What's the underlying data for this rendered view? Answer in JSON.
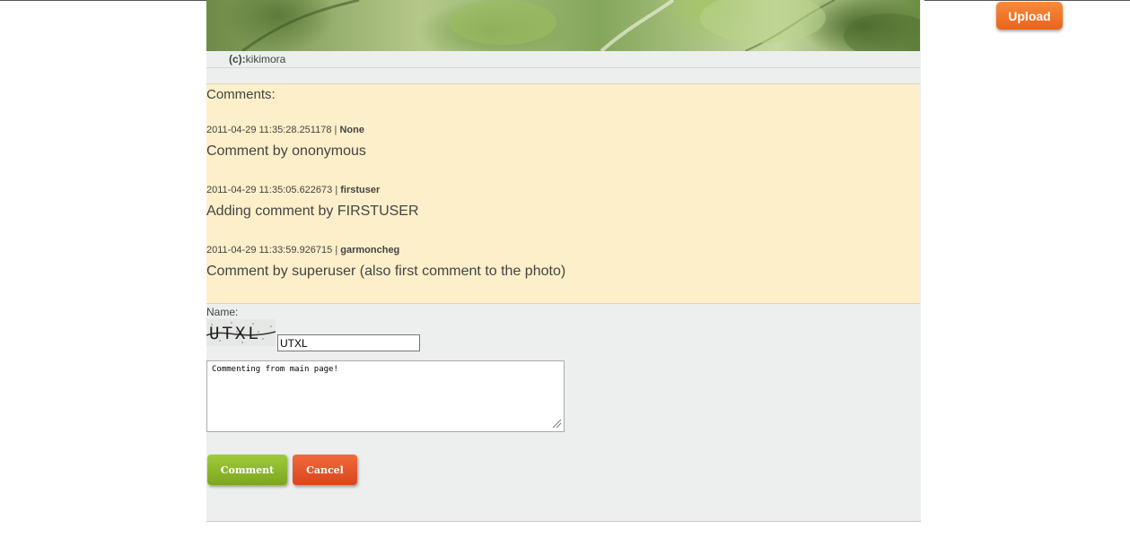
{
  "header": {
    "upload_label": "Upload"
  },
  "photo": {
    "credit_prefix": "(c):",
    "credit_author": "kikimora"
  },
  "comments": {
    "title": "Comments:",
    "items": [
      {
        "timestamp": "2011-04-29 11:35:28.251178",
        "separator": " | ",
        "author": "None",
        "text": "Comment by ononymous"
      },
      {
        "timestamp": "2011-04-29 11:35:05.622673",
        "separator": " | ",
        "author": "firstuser",
        "text": "Adding comment by FIRSTUSER"
      },
      {
        "timestamp": "2011-04-29 11:33:59.926715",
        "separator": " | ",
        "author": "garmoncheg",
        "text": "Comment by superuser (also first comment to the photo)"
      }
    ]
  },
  "form": {
    "name_label": "Name:",
    "captcha_image_text": "UTXL",
    "captcha_value": "UTXL",
    "comment_value": "Commenting from main page!",
    "comment_button": "Comment",
    "cancel_button": "Cancel"
  },
  "colors": {
    "upload": "#f07a2e",
    "comments_bg": "#fdefc9",
    "comment_btn": "#8fb92a",
    "cancel_btn": "#e5522a",
    "form_bg": "#ecefed"
  },
  "icons": {
    "resize": "resize-grip-icon"
  }
}
